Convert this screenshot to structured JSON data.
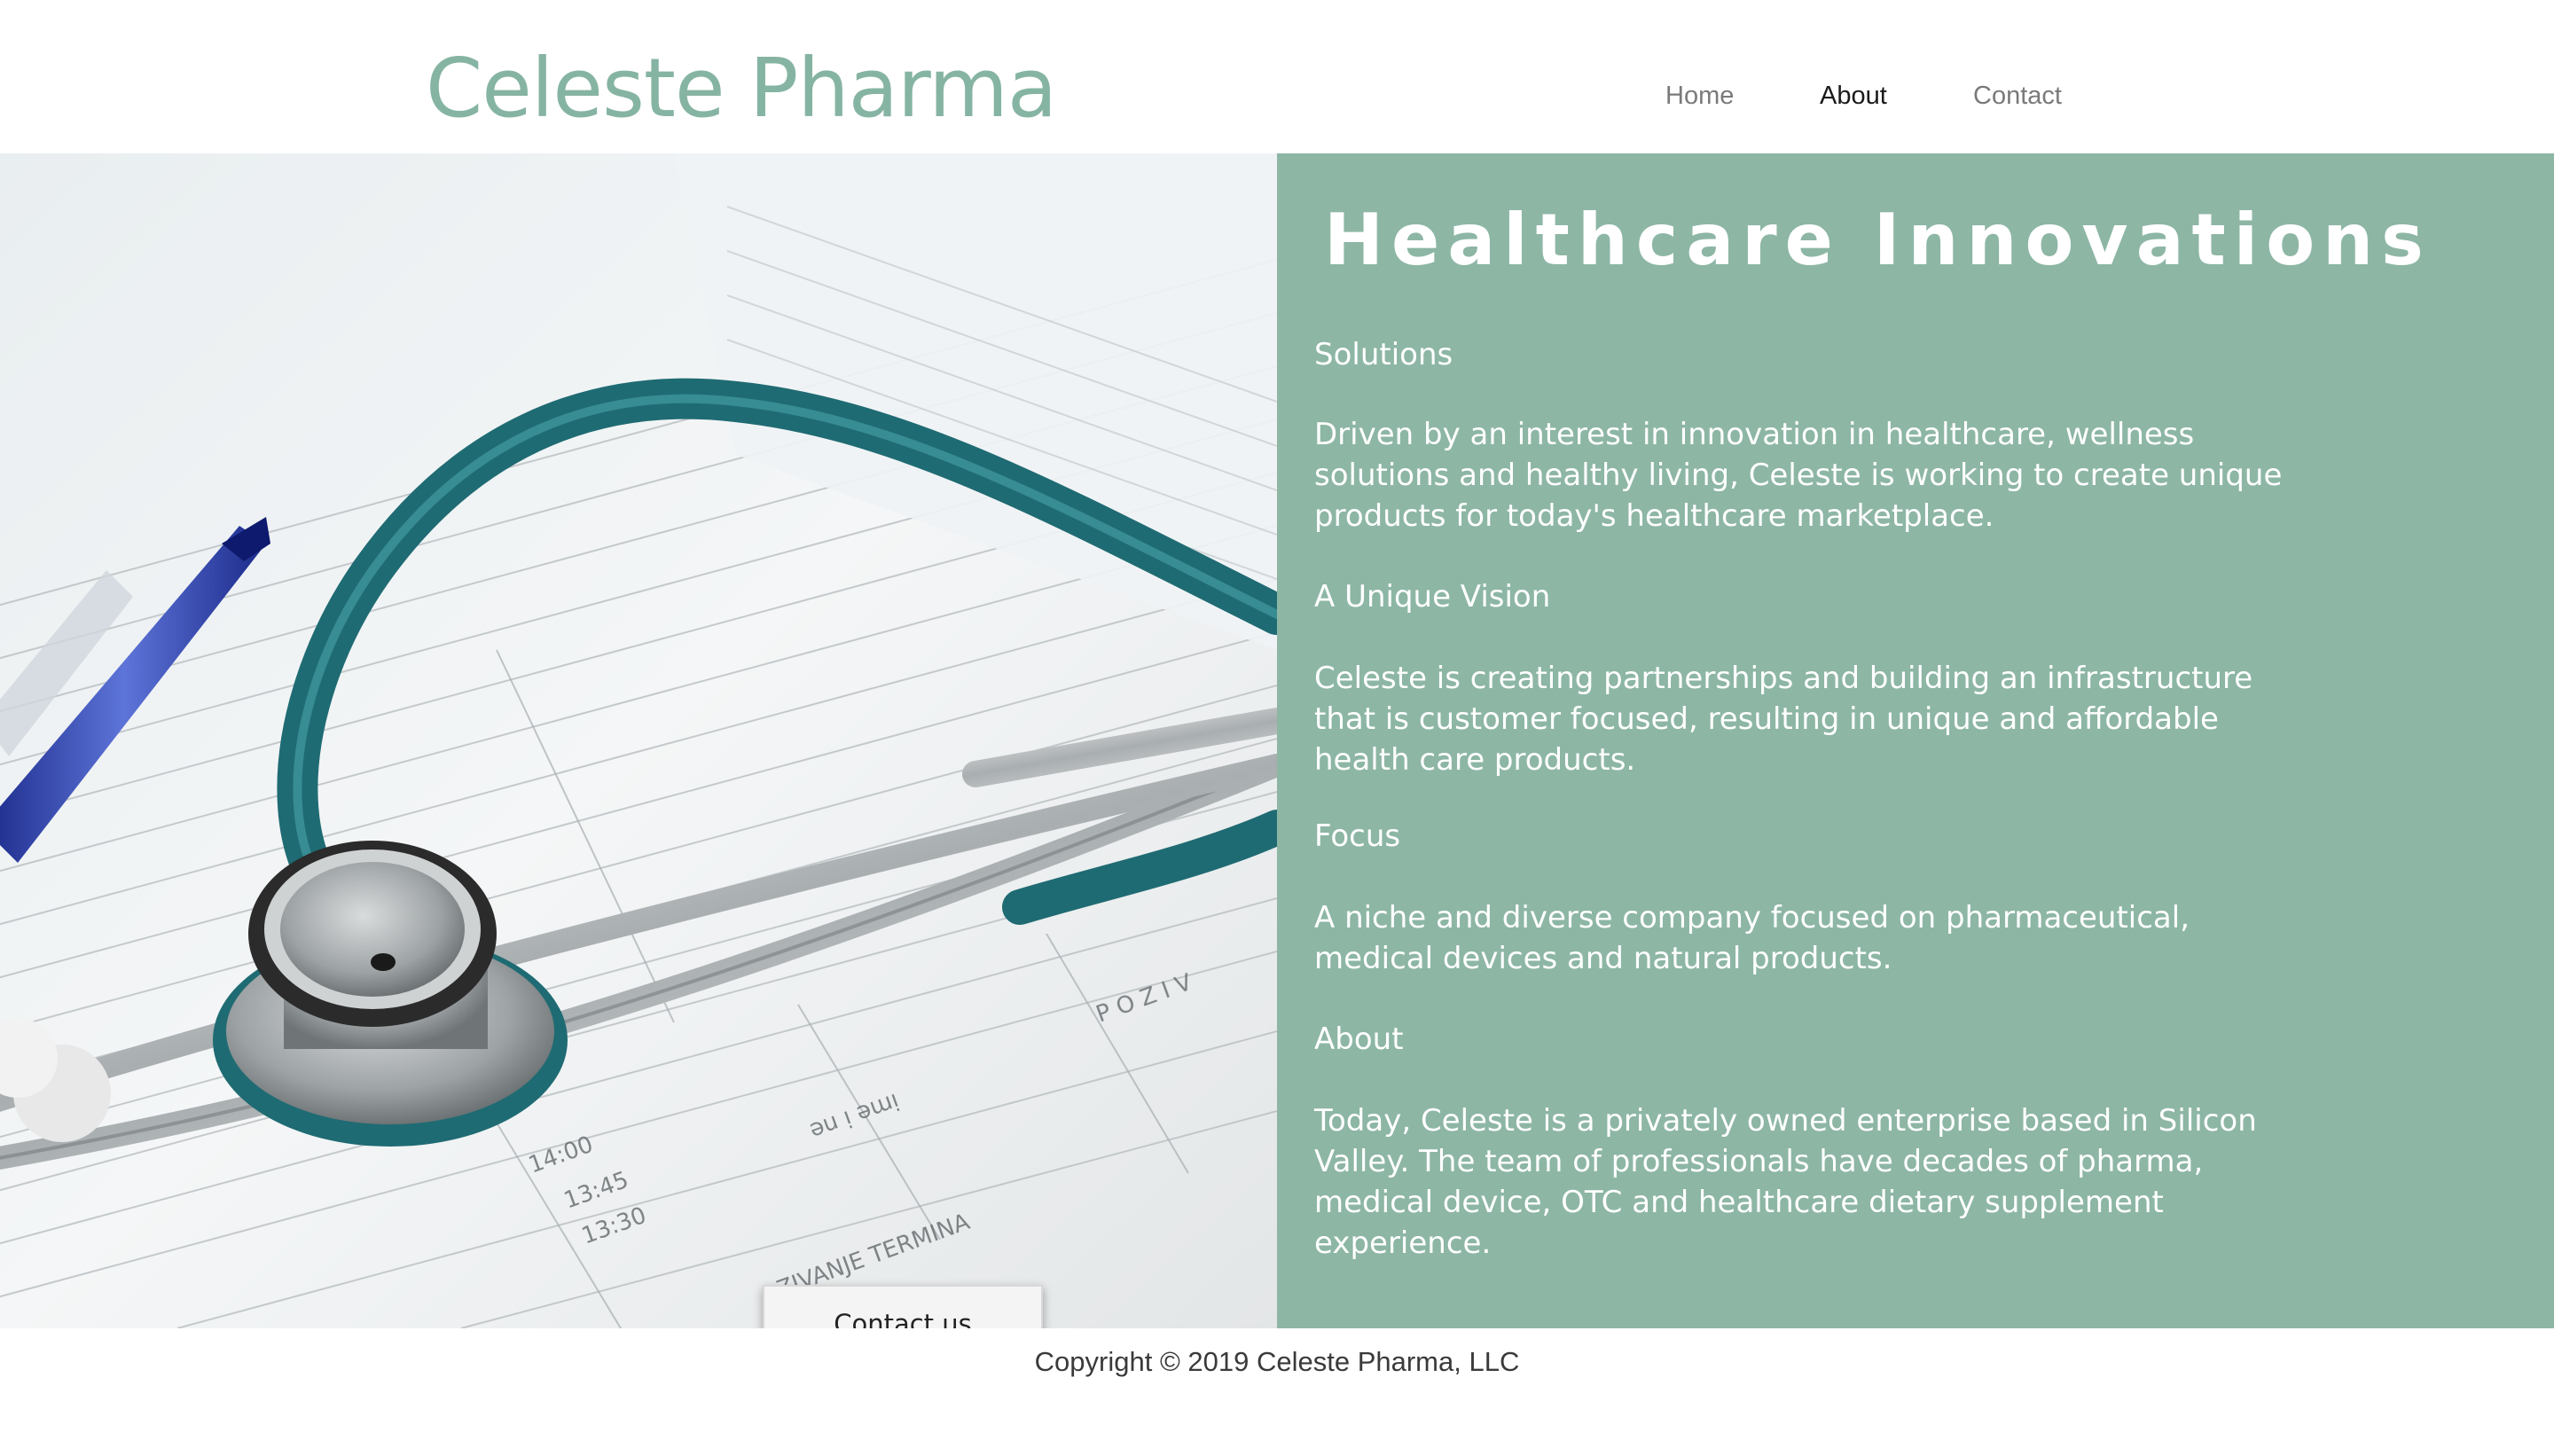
{
  "site": {
    "logo_text": "Celeste Pharma"
  },
  "nav": {
    "items": [
      {
        "label": "Home",
        "active": false
      },
      {
        "label": "About",
        "active": true
      },
      {
        "label": "Contact",
        "active": false
      }
    ]
  },
  "hero": {
    "image_description": "stethoscope-on-medical-chart-photo",
    "contact_button_label": "Contact us"
  },
  "panel": {
    "title": "Healthcare Innovations",
    "sections": [
      {
        "heading": "Solutions",
        "text": "Driven by an interest in innovation in healthcare, wellness solutions and healthy living, Celeste is working to create unique products for today's healthcare marketplace."
      },
      {
        "heading": "A Unique Vision",
        "text": "Celeste is creating partnerships and building an infrastructure that is customer focused, resulting in unique and affordable health care products."
      },
      {
        "heading": "Focus",
        "text": "A niche and diverse company focused on pharmaceutical, medical devices and natural products."
      },
      {
        "heading": "About",
        "text": "Today, Celeste is a privately owned enterprise based in Silicon Valley.  The team of professionals have decades of pharma, medical device, OTC and healthcare dietary supplement experience."
      }
    ]
  },
  "footer": {
    "copyright": "Copyright © 2019 Celeste Pharma, LLC"
  },
  "colors": {
    "accent": "#86b4a3",
    "panel_background": "#8db6a5",
    "text_light": "#ffffff",
    "nav_text": "#7a7a7a",
    "nav_active": "#1a1a1a"
  }
}
